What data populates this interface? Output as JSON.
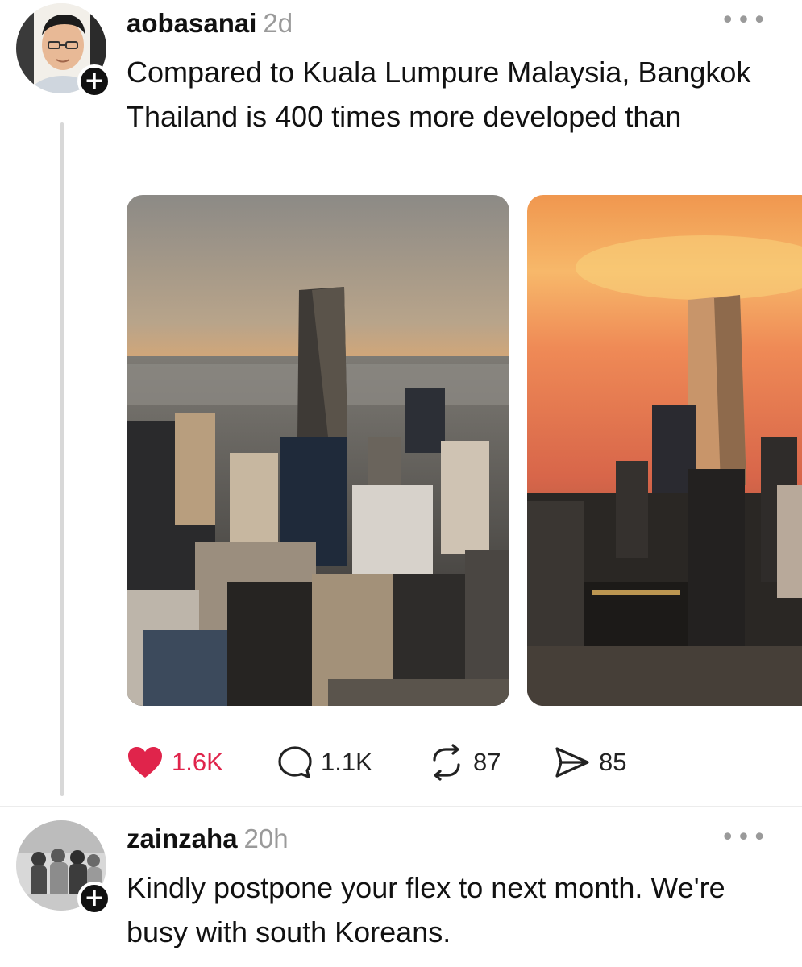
{
  "posts": [
    {
      "username": "aobasanai",
      "time": "2d",
      "text": "Compared to Kuala Lumpure Malaysia, Bangkok Thailand is 400 times more developed than",
      "more_icon": "more-horizontal-icon",
      "follow_icon": "plus-icon",
      "stats": {
        "likes": "1.6K",
        "replies": "1.1K",
        "reposts": "87",
        "shares": "85"
      },
      "icons": [
        "heart-icon",
        "comment-icon",
        "repost-icon",
        "share-icon"
      ],
      "colors": {
        "like": "#e0244b",
        "thread_line": "#d8d8d8"
      }
    },
    {
      "username": "zainzaha",
      "time": "20h",
      "text": "Kindly postpone your flex to next month. We're busy with south Koreans.",
      "more_icon": "more-horizontal-icon",
      "follow_icon": "plus-icon"
    }
  ]
}
